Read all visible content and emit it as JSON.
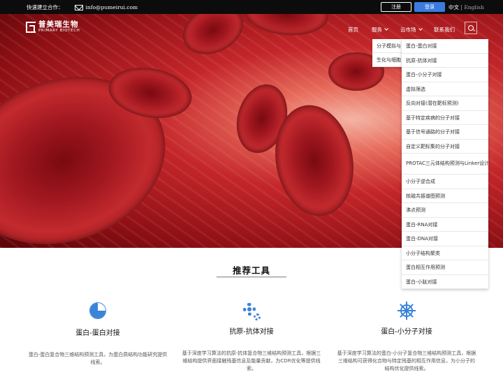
{
  "topbar": {
    "contact_label": "快速建立合作：",
    "email": "info@pumeirui.com",
    "register_label": "注册",
    "login_label": "登录",
    "lang_cn": "中文",
    "lang_sep": "|",
    "lang_en": "English"
  },
  "logo": {
    "cn": "普美瑞生物",
    "en": "PRIMARY BIOTECH"
  },
  "nav": {
    "home": "首页",
    "services": "服务",
    "market": "云市场",
    "contact": "联系我们"
  },
  "submenu_left": [
    "分子模拟与",
    "生化与细胞"
  ],
  "dropdown": [
    "蛋白-蛋白对接",
    "抗原-抗体对接",
    "蛋白-小分子对接",
    "虚拟筛选",
    "反向对接(潜在靶标预测)",
    "基于特定疾病的分子对接",
    "基于信号通路的分子对接",
    "自定义靶标集的分子对接",
    "PROTAC三元体结构预测与Linker设计",
    "小分子逆合成",
    "核磁共振谱图预测",
    "沸点预测",
    "蛋白-RNA对接",
    "蛋白-DNA对接",
    "小分子结构聚类",
    "蛋白相互作用预测",
    "蛋白-小肽对接"
  ],
  "section": {
    "title": "推荐工具"
  },
  "cards": [
    {
      "title": "蛋白-蛋白对接",
      "desc": "蛋白-蛋白复合物三维结构预测工具，为蛋白质结构功能研究提供线索。",
      "icon": "pie-chart-icon"
    },
    {
      "title": "抗原-抗体对接",
      "desc": "基于深度学习算法的抗原-抗体复合物三维结构预测工具，根据三维结构提供界面接触残基信息及能量贡献，为CDR优化等提供线索。",
      "icon": "gear-icon"
    },
    {
      "title": "蛋白-小分子对接",
      "desc": "基于深度学习算法的蛋白-小分子复合物三维结构预测工具，根据三维结构可获得化合物与特定残基的相互作用信息，为小分子的结构优化提供线索。",
      "icon": "ship-wheel-icon"
    }
  ],
  "colors": {
    "accent": "#3a84d8",
    "login_button": "#3b7be0",
    "topbar_bg": "#0c0c0c"
  }
}
